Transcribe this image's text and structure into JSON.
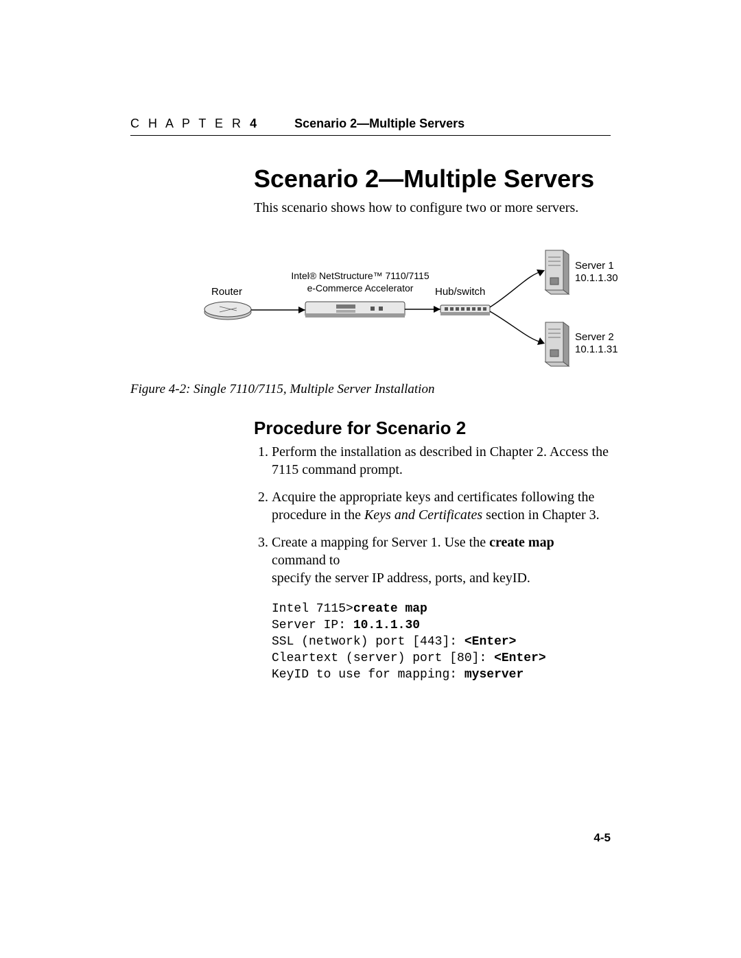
{
  "header": {
    "chapter_word": "C H A P T E R",
    "chapter_num": "4",
    "section": "Scenario 2—Multiple Servers"
  },
  "title": "Scenario 2—Multiple Servers",
  "intro": "This scenario shows how to configure two or more servers.",
  "diagram": {
    "router": "Router",
    "device_line1": "Intel® NetStructure™ 7110/7115",
    "device_line2": "e-Commerce Accelerator",
    "hub": "Hub/switch",
    "server1_name": "Server 1",
    "server1_ip": "10.1.1.30",
    "server2_name": "Server 2",
    "server2_ip": "10.1.1.31"
  },
  "figure_caption": "Figure 4-2:  Single 7110/7115, Multiple Server Installation",
  "subhead": "Procedure for Scenario 2",
  "steps": {
    "s1a": "Perform the installation as described in Chapter 2. Access the ",
    "s1b": "7115 command prompt.",
    "s2a": "Acquire the appropriate keys and certificates following the ",
    "s2b": "procedure in the ",
    "s2c_italic": "Keys and Certificates",
    "s2d": " section in Chapter 3.",
    "s3a": "Create a mapping for Server 1. Use the ",
    "s3b_bold": "create map",
    "s3c": " command to ",
    "s3d": "specify the server IP address, ports, and keyID."
  },
  "code": {
    "l1a": "Intel 7115>",
    "l1b": "create map",
    "l2a": "Server IP: ",
    "l2b": "10.1.1.30",
    "l3a": "SSL (network) port [443]: ",
    "l3b": "<Enter>",
    "l4a": "Cleartext (server) port [80]: ",
    "l4b": "<Enter>",
    "l5a": "KeyID to use for mapping: ",
    "l5b": "myserver"
  },
  "page_number": "4-5"
}
